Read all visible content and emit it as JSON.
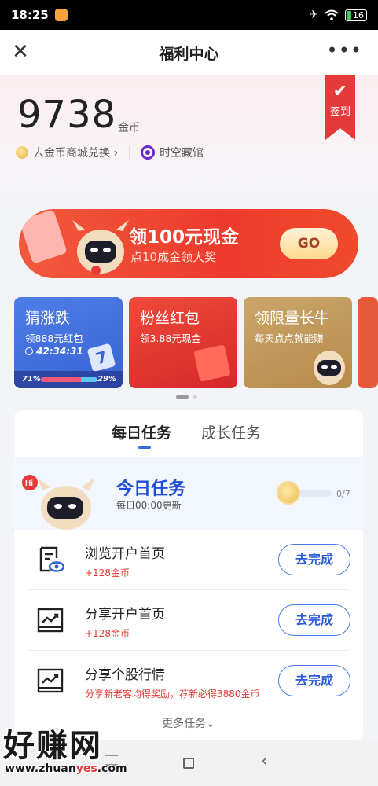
{
  "status_bar": {
    "time": "18:25",
    "battery": "16"
  },
  "nav": {
    "title": "福利中心",
    "close_icon": "close-icon",
    "more_icon": "more-icon"
  },
  "header": {
    "coins": "9738",
    "coins_unit": "金币",
    "mall_link": "去金币商城兑换",
    "mall_chevron": "›",
    "museum_link": "时空藏馆",
    "signin_label": "签到"
  },
  "banner": {
    "title": "领100元现金",
    "subtitle": "点10成金领大奖",
    "go_label": "GO"
  },
  "cards": [
    {
      "title": "猜涨跌",
      "subtitle": "领888元红包",
      "timer": "42:34:31",
      "left_pct": "71%",
      "right_pct": "29%",
      "up_fraction": 0.71,
      "badge": "7"
    },
    {
      "title": "粉丝红包",
      "subtitle": "领3.88元现金"
    },
    {
      "title": "领限量长牛",
      "subtitle": "每天点点就能赚"
    }
  ],
  "pager": {
    "count": 2,
    "active": 0
  },
  "tasks": {
    "tabs": [
      {
        "label": "每日任务",
        "active": true
      },
      {
        "label": "成长任务",
        "active": false
      }
    ],
    "today": {
      "title": "今日任务",
      "subtitle": "每日00:00更新",
      "progress": "0/7",
      "progress_value": 0,
      "progress_total": 7,
      "hi_badge": "Hi"
    },
    "items": [
      {
        "name": "浏览开户首页",
        "reward": "+128金币",
        "button": "去完成",
        "icon": "browse-doc-icon"
      },
      {
        "name": "分享开户首页",
        "reward": "+128金币",
        "button": "去完成",
        "icon": "share-chart-icon"
      },
      {
        "name": "分享个股行情",
        "reward": "分享新老客均得奖励，荐新必得3880金币",
        "button": "去完成",
        "icon": "share-chart-icon"
      }
    ],
    "more": "更多任务",
    "more_chevron": "⌄"
  },
  "watermark": {
    "text": "好赚网",
    "url_prefix": "www.zhuan",
    "url_highlight": "yes",
    "url_suffix": ".com"
  },
  "colors": {
    "accent_blue": "#2a5bd6",
    "reward_red": "#e53935",
    "banner_red": "#ee3a2c"
  }
}
